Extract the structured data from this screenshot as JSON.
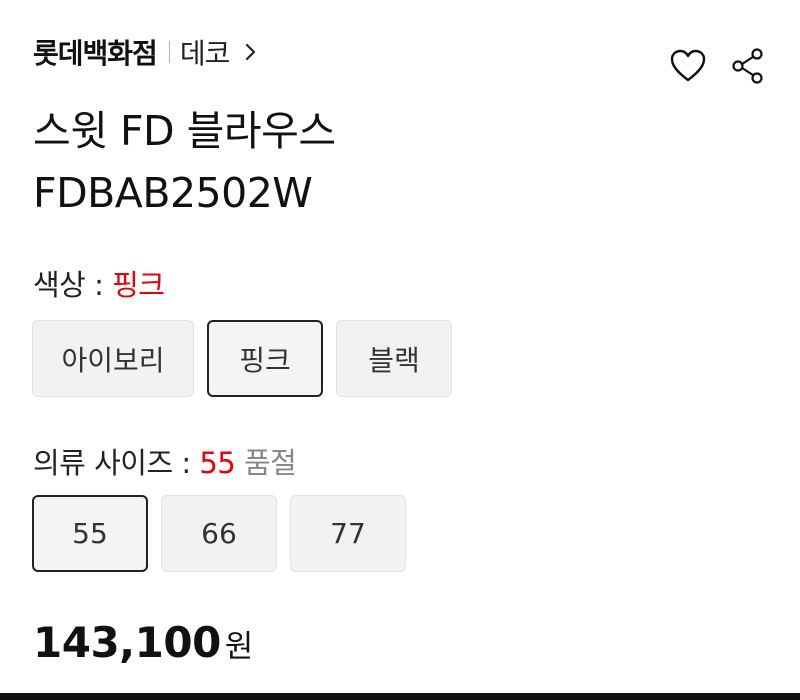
{
  "header": {
    "brand": "롯데백화점",
    "sub_brand": "데코"
  },
  "icons": {
    "wishlist": "heart-icon",
    "share": "share-icon",
    "breadcrumb": "chevron-right-icon"
  },
  "product": {
    "title_line1": "스윗 FD 블라우스",
    "title_line2": "FDBAB2502W"
  },
  "color_option": {
    "label": "색상 : ",
    "selected": "핑크",
    "choices": [
      "아이보리",
      "핑크",
      "블랙"
    ]
  },
  "size_option": {
    "label": "의류 사이즈 : ",
    "selected": "55",
    "status": "품절",
    "choices": [
      "55",
      "66",
      "77"
    ]
  },
  "price": {
    "amount": "143,100",
    "unit": "원"
  },
  "colors": {
    "accent": "#e8000b",
    "selected_border": "#222222",
    "option_bg": "#f2f2f2"
  }
}
